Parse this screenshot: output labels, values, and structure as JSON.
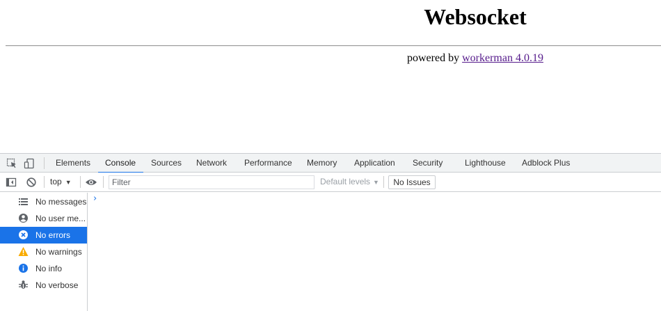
{
  "page": {
    "title": "Websocket",
    "powered_prefix": "powered by ",
    "powered_link": "workerman 4.0.19"
  },
  "devtools": {
    "tabs": [
      {
        "label": "Elements"
      },
      {
        "label": "Console",
        "active": true
      },
      {
        "label": "Sources"
      },
      {
        "label": "Network"
      },
      {
        "label": "Performance"
      },
      {
        "label": "Memory"
      },
      {
        "label": "Application"
      },
      {
        "label": "Security"
      },
      {
        "label": "Lighthouse"
      },
      {
        "label": "Adblock Plus"
      }
    ],
    "toolbar": {
      "context": "top",
      "filter_placeholder": "Filter",
      "levels": "Default levels",
      "issues": "No Issues"
    },
    "sidebar": [
      {
        "label": "No messages",
        "icon": "list-icon"
      },
      {
        "label": "No user me...",
        "icon": "user-icon"
      },
      {
        "label": "No errors",
        "icon": "error-icon",
        "selected": true
      },
      {
        "label": "No warnings",
        "icon": "warning-icon"
      },
      {
        "label": "No info",
        "icon": "info-icon"
      },
      {
        "label": "No verbose",
        "icon": "verbose-icon"
      }
    ],
    "prompt_symbol": "›",
    "colors": {
      "accent": "#1a73e8",
      "warning": "#f9ab00",
      "toolbar_bg": "#f1f3f4"
    }
  }
}
